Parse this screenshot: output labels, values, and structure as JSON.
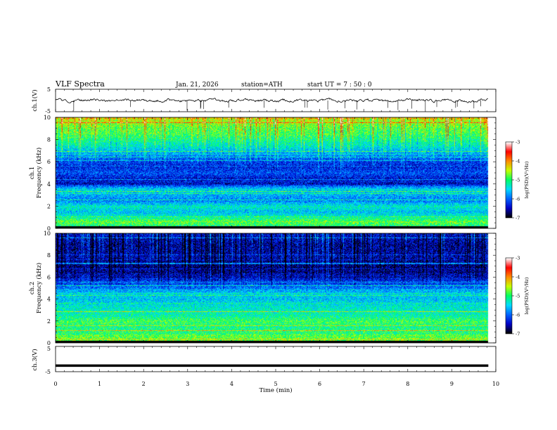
{
  "header": {
    "title": "VLF  Spectra",
    "date": "Jan. 21, 2026",
    "station": "station=ATH",
    "start": "start  UT  =   7  : 50 : 0"
  },
  "chart_data": {
    "type": "heatmap",
    "x": {
      "label": "Time  (min)",
      "range": [
        0,
        10
      ],
      "ticks": [
        "0",
        "1",
        "2",
        "3",
        "4",
        "5",
        "6",
        "7",
        "8",
        "9",
        "10"
      ],
      "data_end": 9.83
    },
    "ch1_waveform": {
      "ylabel": "ch.1(V)",
      "ylim": [
        -5,
        5
      ],
      "ticks": [
        "5",
        "-5"
      ],
      "baseline": 0,
      "noise_amplitude": 1.0
    },
    "ch1_spectrogram": {
      "ylabel_1": "ch.1",
      "ylabel_2": "Frequency  (kHz)",
      "ylim": [
        0,
        10
      ],
      "ticks": [
        "0",
        "2",
        "4",
        "6",
        "8",
        "10"
      ],
      "band_profile_log_psd": [
        [
          0.0,
          -5.5
        ],
        [
          0.3,
          -5.0
        ],
        [
          0.6,
          -4.8
        ],
        [
          1.0,
          -5.2
        ],
        [
          1.5,
          -5.6
        ],
        [
          2.0,
          -5.3
        ],
        [
          2.5,
          -5.9
        ],
        [
          3.0,
          -5.7
        ],
        [
          3.5,
          -5.4
        ],
        [
          4.0,
          -6.3
        ],
        [
          4.5,
          -6.4
        ],
        [
          5.0,
          -6.1
        ],
        [
          5.5,
          -6.3
        ],
        [
          6.0,
          -6.2
        ],
        [
          6.5,
          -5.9
        ],
        [
          7.0,
          -5.6
        ],
        [
          7.5,
          -5.3
        ],
        [
          8.0,
          -5.1
        ],
        [
          8.5,
          -4.9
        ],
        [
          9.0,
          -4.8
        ],
        [
          9.5,
          -4.6
        ],
        [
          10.0,
          -4.4
        ]
      ]
    },
    "ch2_spectrogram": {
      "ylabel_1": "ch.2",
      "ylabel_2": "Frequency  (kHz)",
      "ylim": [
        0,
        10
      ],
      "ticks": [
        "0",
        "2",
        "4",
        "6",
        "8",
        "10"
      ],
      "band_profile_log_psd": [
        [
          0.0,
          -4.6
        ],
        [
          0.5,
          -4.8
        ],
        [
          1.0,
          -5.0
        ],
        [
          1.5,
          -5.1
        ],
        [
          2.0,
          -4.9
        ],
        [
          2.5,
          -5.2
        ],
        [
          3.0,
          -5.3
        ],
        [
          3.5,
          -5.4
        ],
        [
          4.0,
          -5.6
        ],
        [
          4.5,
          -5.5
        ],
        [
          5.0,
          -5.9
        ],
        [
          5.5,
          -6.2
        ],
        [
          6.0,
          -6.4
        ],
        [
          6.5,
          -6.6
        ],
        [
          7.0,
          -6.7
        ],
        [
          7.5,
          -6.6
        ],
        [
          8.0,
          -6.5
        ],
        [
          8.5,
          -6.6
        ],
        [
          9.0,
          -6.6
        ],
        [
          9.5,
          -6.5
        ],
        [
          10.0,
          -6.4
        ]
      ]
    },
    "ch3_waveform": {
      "ylabel": "ch.3(V)",
      "ylim": [
        -5,
        5
      ],
      "ticks": [
        "5",
        "-5"
      ],
      "baseline": -2.6
    },
    "colorbar": {
      "label": "log(PSD)(V²/Hz)",
      "range": [
        -7,
        -3
      ],
      "ticks": [
        "-3",
        "-4",
        "-5",
        "-6",
        "-7"
      ],
      "colors": [
        "#000000",
        "#0000c8",
        "#0064ff",
        "#00dcff",
        "#00ff64",
        "#c8ff00",
        "#ff8c00",
        "#ff0000",
        "#ffffff"
      ]
    }
  }
}
